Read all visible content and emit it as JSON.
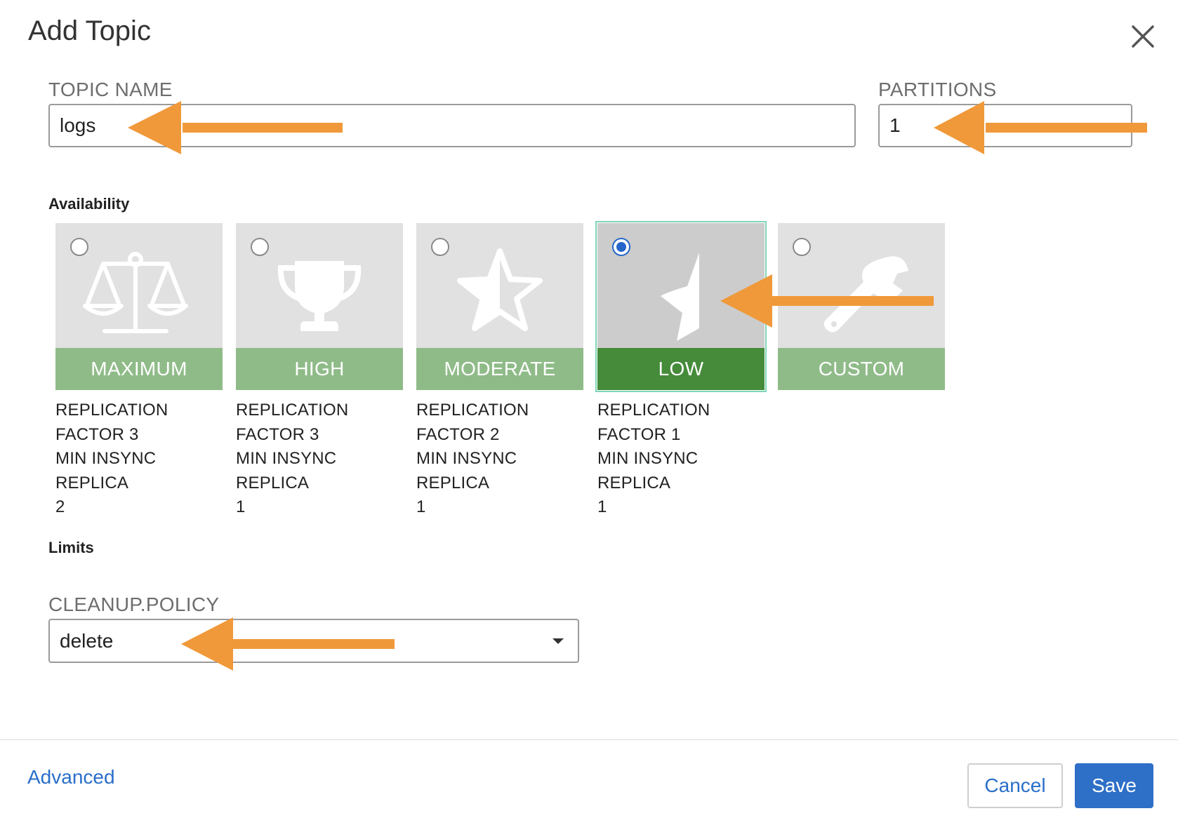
{
  "dialog": {
    "title": "Add Topic",
    "close_icon": "close-icon"
  },
  "topic_name": {
    "label": "TOPIC NAME",
    "value": "logs"
  },
  "partitions": {
    "label": "PARTITIONS",
    "value": "1"
  },
  "availability": {
    "heading": "Availability",
    "selected": "LOW",
    "options": [
      {
        "label": "MAXIMUM",
        "icon": "scales-icon",
        "selected": false,
        "lines": [
          "REPLICATION",
          "FACTOR 3",
          "MIN INSYNC REPLICA",
          "2"
        ]
      },
      {
        "label": "HIGH",
        "icon": "trophy-icon",
        "selected": false,
        "lines": [
          "REPLICATION",
          "FACTOR 3",
          "MIN INSYNC REPLICA",
          "1"
        ]
      },
      {
        "label": "MODERATE",
        "icon": "half-star-icon",
        "selected": false,
        "lines": [
          "REPLICATION",
          "FACTOR 2",
          "MIN INSYNC REPLICA",
          "1"
        ]
      },
      {
        "label": "LOW",
        "icon": "star-quarter-icon",
        "selected": true,
        "lines": [
          "REPLICATION",
          "FACTOR 1",
          "MIN INSYNC REPLICA",
          "1"
        ]
      },
      {
        "label": "CUSTOM",
        "icon": "wrench-icon",
        "selected": false,
        "lines": []
      }
    ]
  },
  "limits": {
    "heading": "Limits",
    "cleanup_policy": {
      "label": "CLEANUP.POLICY",
      "value": "delete"
    }
  },
  "footer": {
    "advanced_label": "Advanced",
    "cancel_label": "Cancel",
    "save_label": "Save"
  },
  "colors": {
    "accent_blue": "#2e6fc7",
    "card_band": "#8fbb88",
    "card_band_selected": "#458b3a",
    "annotation_arrow": "#f0993a"
  }
}
